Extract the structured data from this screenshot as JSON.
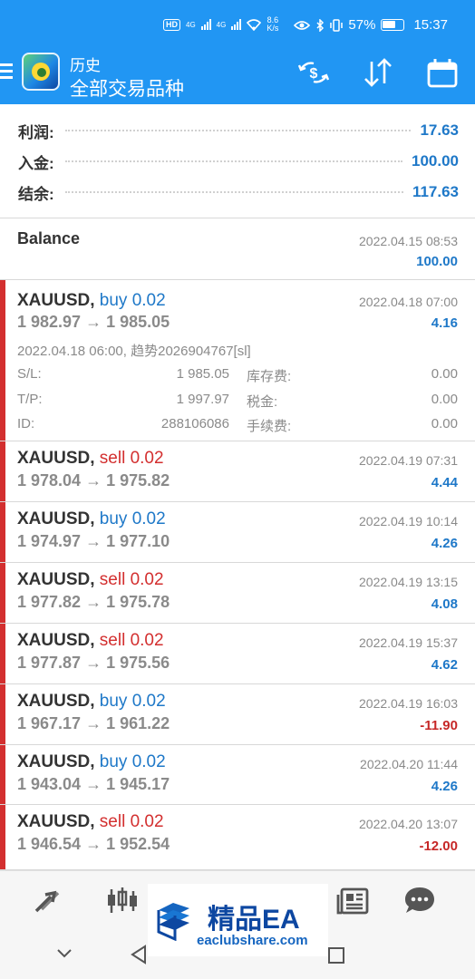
{
  "status_bar": {
    "hd": "HD",
    "net1": "4G",
    "net2": "4G",
    "speed_value": "8.6",
    "speed_unit": "K/s",
    "battery": "57%",
    "time": "15:37"
  },
  "header": {
    "subtitle": "历史",
    "title": "全部交易品种",
    "icon_names": [
      "currency-exchange-icon",
      "sort-icon",
      "calendar-icon"
    ]
  },
  "summary": {
    "profit_label": "利润:",
    "profit_value": "17.63",
    "deposit_label": "入金:",
    "deposit_value": "100.00",
    "balance_label": "结余:",
    "balance_value": "117.63"
  },
  "balance_entry": {
    "label": "Balance",
    "time": "2022.04.15 08:53",
    "amount": "100.00"
  },
  "expanded_trade": {
    "symbol": "XAUUSD,",
    "direction": "buy 0.02",
    "direction_type": "buy",
    "prices": "1 982.97 → 1 985.05",
    "time": "2022.04.18 07:00",
    "profit": "4.16",
    "open_info": "2022.04.18 06:00, 趋势2026904767[sl]",
    "sl_label": "S/L:",
    "sl_value": "1 985.05",
    "tp_label": "T/P:",
    "tp_value": "1 997.97",
    "id_label": "ID:",
    "id_value": "288106086",
    "swap_label": "库存费:",
    "swap_value": "0.00",
    "tax_label": "税金:",
    "tax_value": "0.00",
    "commission_label": "手续费:",
    "commission_value": "0.00"
  },
  "trades": [
    {
      "symbol": "XAUUSD,",
      "direction": "sell 0.02",
      "direction_type": "sell",
      "prices": "1 978.04 → 1 975.82",
      "time": "2022.04.19 07:31",
      "profit": "4.44",
      "negative": false
    },
    {
      "symbol": "XAUUSD,",
      "direction": "buy 0.02",
      "direction_type": "buy",
      "prices": "1 974.97 → 1 977.10",
      "time": "2022.04.19 10:14",
      "profit": "4.26",
      "negative": false
    },
    {
      "symbol": "XAUUSD,",
      "direction": "sell 0.02",
      "direction_type": "sell",
      "prices": "1 977.82 → 1 975.78",
      "time": "2022.04.19 13:15",
      "profit": "4.08",
      "negative": false
    },
    {
      "symbol": "XAUUSD,",
      "direction": "sell 0.02",
      "direction_type": "sell",
      "prices": "1 977.87 → 1 975.56",
      "time": "2022.04.19 15:37",
      "profit": "4.62",
      "negative": false
    },
    {
      "symbol": "XAUUSD,",
      "direction": "buy 0.02",
      "direction_type": "buy",
      "prices": "1 967.17 → 1 961.22",
      "time": "2022.04.19 16:03",
      "profit": "-11.90",
      "negative": true
    },
    {
      "symbol": "XAUUSD,",
      "direction": "buy 0.02",
      "direction_type": "buy",
      "prices": "1 943.04 → 1 945.17",
      "time": "2022.04.20 11:44",
      "profit": "4.26",
      "negative": false
    },
    {
      "symbol": "XAUUSD,",
      "direction": "sell 0.02",
      "direction_type": "sell",
      "prices": "1 946.54 → 1 952.54",
      "time": "2022.04.20 13:07",
      "profit": "-12.00",
      "negative": true
    }
  ],
  "bottom_nav": {
    "icon_names": [
      "quotes-icon",
      "chart-icon",
      "trade-icon",
      "news-icon",
      "chat-icon"
    ]
  },
  "watermark": {
    "title": "精品EA",
    "site": "eaclubshare.com"
  },
  "colors": {
    "header_blue": "#2196f3",
    "buy_blue": "#1e78c8",
    "sell_red": "#d32f2f",
    "negative_red": "#c62828"
  }
}
